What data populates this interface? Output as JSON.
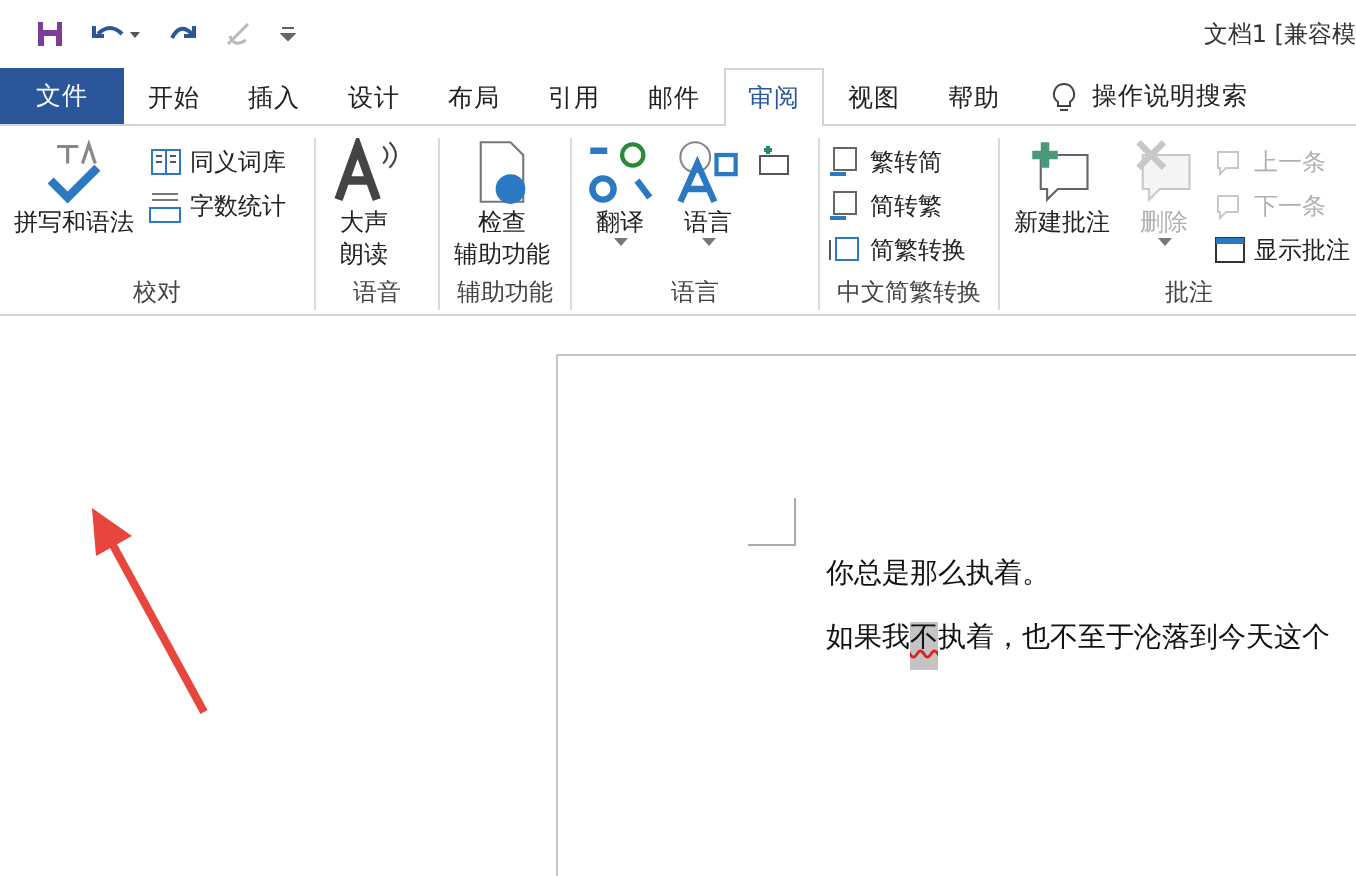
{
  "title_bar": {
    "title": "文档1 [兼容模"
  },
  "tabs": [
    {
      "label": "文件",
      "kind": "file",
      "selected": false
    },
    {
      "label": "开始",
      "kind": "normal",
      "selected": false
    },
    {
      "label": "插入",
      "kind": "normal",
      "selected": false
    },
    {
      "label": "设计",
      "kind": "normal",
      "selected": false
    },
    {
      "label": "布局",
      "kind": "normal",
      "selected": false
    },
    {
      "label": "引用",
      "kind": "normal",
      "selected": false
    },
    {
      "label": "邮件",
      "kind": "normal",
      "selected": false
    },
    {
      "label": "审阅",
      "kind": "normal",
      "selected": true
    },
    {
      "label": "视图",
      "kind": "normal",
      "selected": false
    },
    {
      "label": "帮助",
      "kind": "normal",
      "selected": false
    }
  ],
  "search": {
    "label": "操作说明搜索"
  },
  "ribbon_groups": [
    {
      "label": "校对",
      "buttons": [
        {
          "lines": [
            "拼写和语法"
          ],
          "kind": "large",
          "disabled": false,
          "dropdown": false
        },
        {
          "lines": [
            "同义词库"
          ],
          "kind": "small",
          "disabled": false
        },
        {
          "lines": [
            "字数统计"
          ],
          "kind": "small",
          "disabled": false
        }
      ]
    },
    {
      "label": "语音",
      "buttons": [
        {
          "lines": [
            "大声",
            "朗读"
          ],
          "kind": "large",
          "disabled": false,
          "dropdown": false
        }
      ]
    },
    {
      "label": "辅助功能",
      "buttons": [
        {
          "lines": [
            "检查",
            "辅助功能"
          ],
          "kind": "large",
          "disabled": false,
          "dropdown": false
        }
      ]
    },
    {
      "label": "语言",
      "buttons": [
        {
          "lines": [
            "翻译"
          ],
          "kind": "large",
          "disabled": false,
          "dropdown": true
        },
        {
          "lines": [
            "语言"
          ],
          "kind": "large",
          "disabled": false,
          "dropdown": true
        },
        {
          "kind": "icon",
          "disabled": false
        }
      ]
    },
    {
      "label": "中文简繁转换",
      "buttons": [
        {
          "lines": [
            "繁转简"
          ],
          "kind": "small",
          "disabled": false
        },
        {
          "lines": [
            "简转繁"
          ],
          "kind": "small",
          "disabled": false
        },
        {
          "lines": [
            "简繁转换"
          ],
          "kind": "small",
          "disabled": false
        }
      ]
    },
    {
      "label": "批注",
      "buttons": [
        {
          "lines": [
            "新建批注"
          ],
          "kind": "large",
          "disabled": false,
          "dropdown": false
        },
        {
          "lines": [
            "删除"
          ],
          "kind": "large",
          "disabled": true,
          "dropdown": true
        },
        {
          "lines": [
            "上一条"
          ],
          "kind": "small",
          "disabled": true
        },
        {
          "lines": [
            "下一条"
          ],
          "kind": "small",
          "disabled": true
        },
        {
          "lines": [
            "显示批注"
          ],
          "kind": "small",
          "disabled": false
        }
      ]
    }
  ],
  "document": {
    "paragraphs": [
      [
        {
          "text": "你总是那么执着。",
          "highlighted": false,
          "spell_error": false
        }
      ],
      [
        {
          "text": "如果我",
          "highlighted": false,
          "spell_error": false
        },
        {
          "text": "不",
          "highlighted": true,
          "spell_error": true
        },
        {
          "text": "执着，也不至于沦落到今天这个",
          "highlighted": false,
          "spell_error": false
        }
      ]
    ]
  }
}
